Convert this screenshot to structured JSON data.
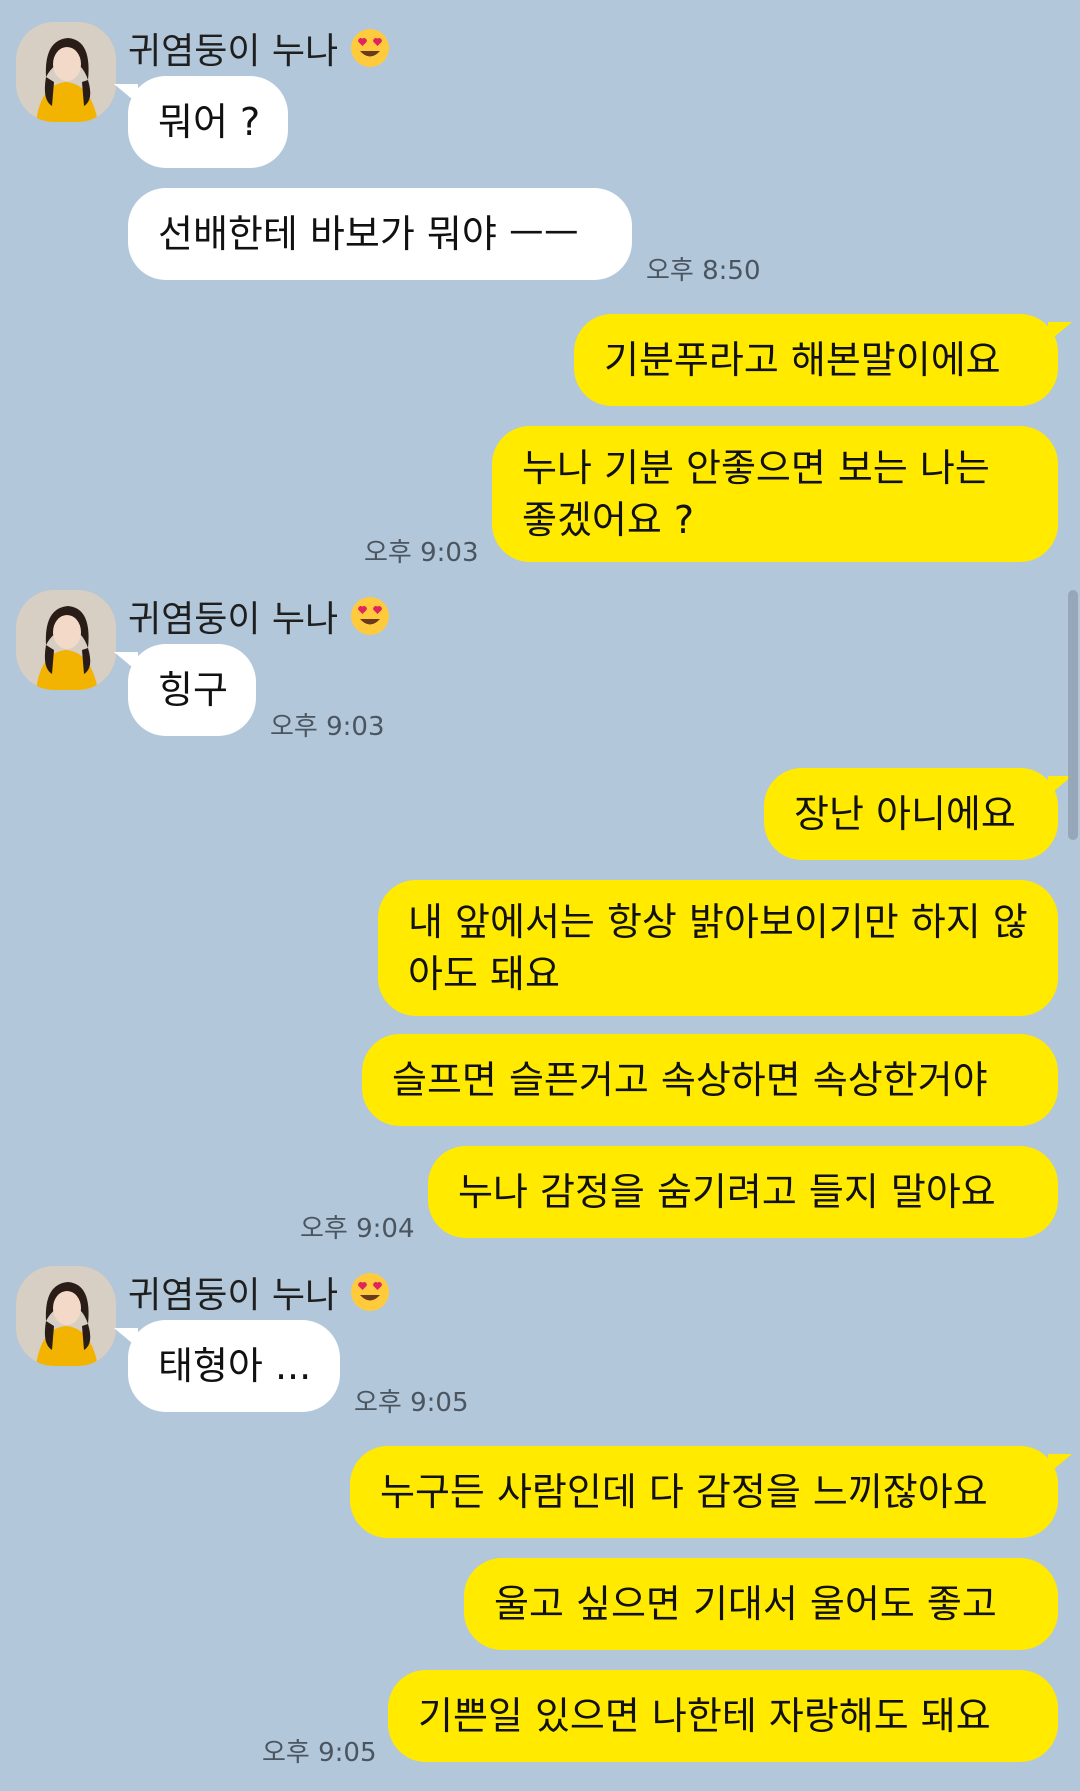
{
  "sender_name": "귀염둥이 누나",
  "colors": {
    "background": "#b2c7da",
    "incoming_bubble": "#ffffff",
    "outgoing_bubble": "#ffea00"
  },
  "icons": {
    "avatar": "profile-photo",
    "name_emoji": "smiling-face-with-heart-eyes"
  },
  "messages": [
    {
      "text": "뭐어 ?"
    },
    {
      "text": "선배한테 바보가 뭐야 ㅡㅡ"
    },
    {
      "text": "기분푸라고 해본말이에요"
    },
    {
      "text": "누나 기분 안좋으면 보는 나는 좋겠어요 ?"
    },
    {
      "text": "힝구"
    },
    {
      "text": "장난 아니에요"
    },
    {
      "text": "내 앞에서는 항상 밝아보이기만 하지 않아도 돼요"
    },
    {
      "text": "슬프면 슬픈거고 속상하면 속상한거야"
    },
    {
      "text": "누나 감정을 숨기려고 들지 말아요"
    },
    {
      "text": "태형아 ..."
    },
    {
      "text": "누구든 사람인데 다 감정을 느끼잖아요"
    },
    {
      "text": "울고 싶으면 기대서 울어도 좋고"
    },
    {
      "text": "기쁜일 있으면 나한테 자랑해도 돼요"
    }
  ],
  "times": [
    "오후 8:50",
    "오후 9:03",
    "오후 9:03",
    "오후 9:04",
    "오후 9:05",
    "오후 9:05"
  ]
}
